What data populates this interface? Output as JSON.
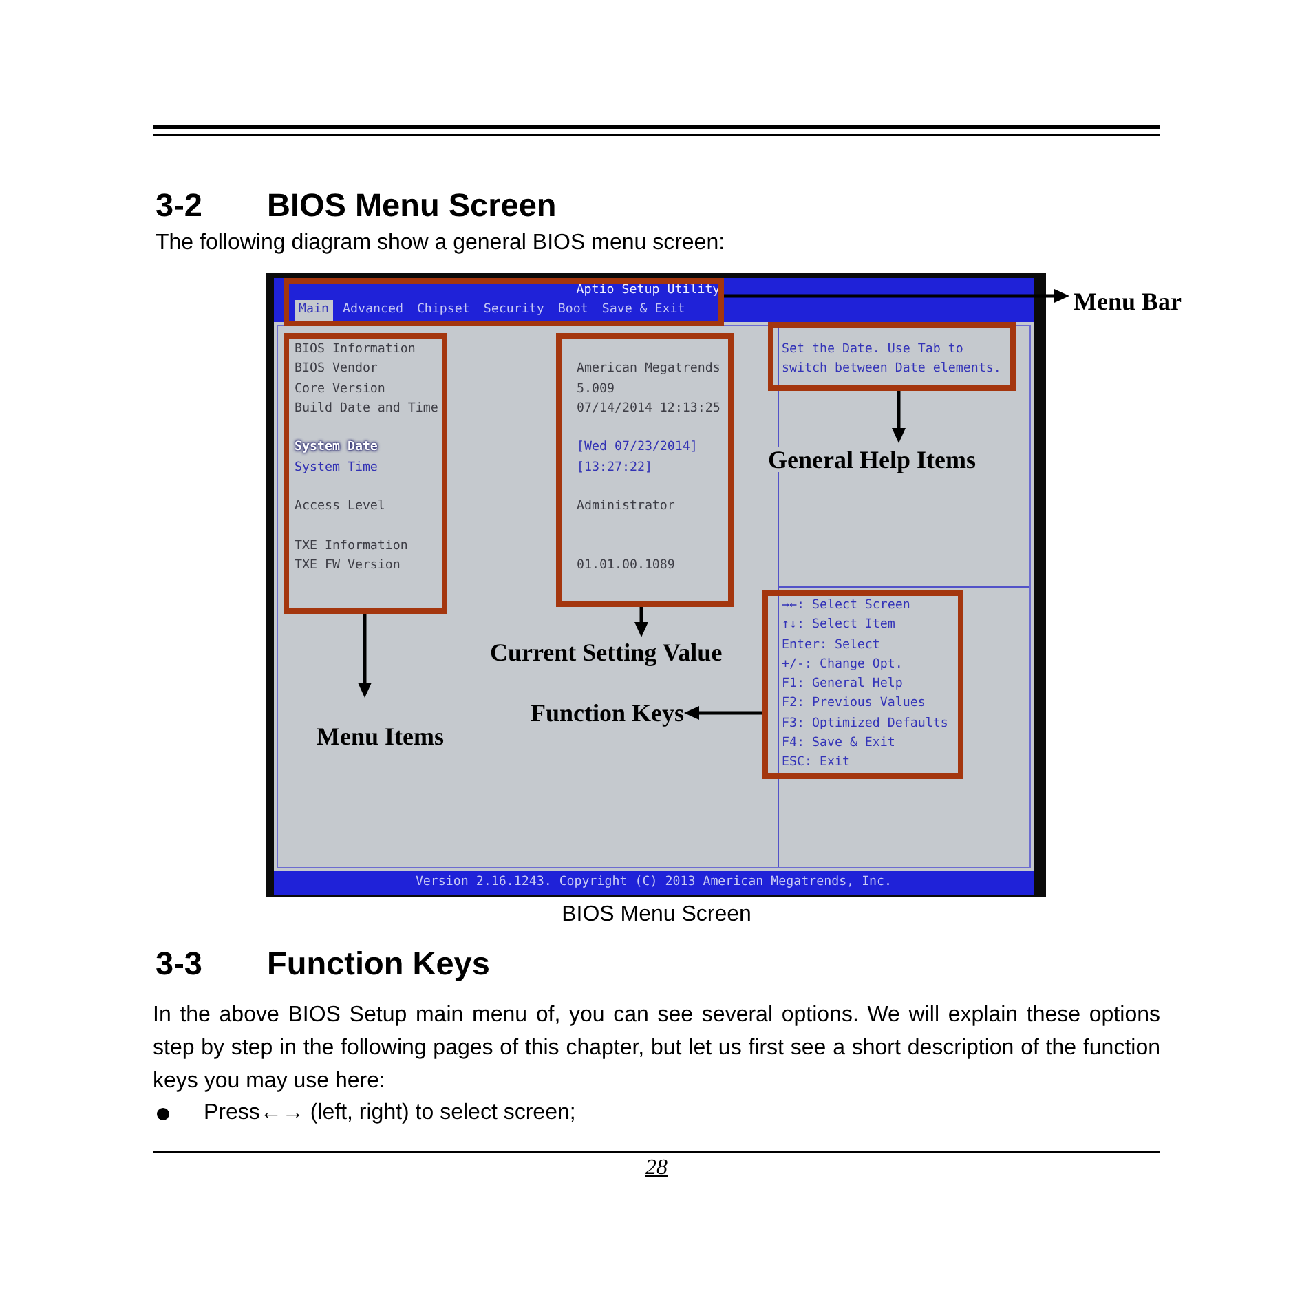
{
  "top_section": {
    "number": "3-2",
    "title": "BIOS Menu Screen",
    "intro": "The following diagram show a general BIOS menu screen:"
  },
  "figure": {
    "bios_screen": {
      "title": "Aptio Setup Utility",
      "tabs": [
        {
          "label": "Main",
          "selected": true
        },
        {
          "label": "Advanced",
          "selected": false
        },
        {
          "label": "Chipset",
          "selected": false
        },
        {
          "label": "Security",
          "selected": false
        },
        {
          "label": "Boot",
          "selected": false
        },
        {
          "label": "Save & Exit",
          "selected": false
        }
      ],
      "setting_groups": [
        {
          "items": [
            {
              "kind": "info",
              "label": "BIOS Information",
              "selected": false
            },
            {
              "kind": "info",
              "label": "BIOS Vendor",
              "value": "American Megatrends",
              "selected": false
            },
            {
              "kind": "info",
              "label": "Core Version",
              "value": "5.009",
              "selected": false
            },
            {
              "kind": "info",
              "label": "Build Date and Time",
              "value": "07/14/2014 12:13:25",
              "selected": false
            }
          ]
        },
        {
          "items": [
            {
              "kind": "setting",
              "label": "System Date",
              "value": "[Wed 07/23/2014]",
              "selected": true
            },
            {
              "kind": "setting",
              "label": "System Time",
              "value": "[13:27:22]",
              "selected": false
            }
          ]
        },
        {
          "items": [
            {
              "kind": "info",
              "label": "Access Level",
              "value": "Administrator",
              "selected": false
            }
          ]
        },
        {
          "items": [
            {
              "kind": "info",
              "label": "TXE Information",
              "selected": false
            },
            {
              "kind": "info",
              "label": "TXE FW Version",
              "value": "01.01.00.1089",
              "selected": false
            }
          ]
        }
      ],
      "help_text": "Set the Date. Use Tab to switch between Date elements.",
      "key_hints": [
        "→←: Select Screen",
        "↑↓: Select Item",
        "Enter: Select",
        "+/-: Change Opt.",
        "F1: General Help",
        "F2: Previous Values",
        "F3: Optimized Defaults",
        "F4: Save & Exit",
        "ESC: Exit"
      ],
      "version": "Version 2.16.1243. Copyright (C) 2013 American Megatrends, Inc."
    },
    "callouts": [
      {
        "label": "Menu Bar"
      },
      {
        "label": "Menu Items"
      },
      {
        "label": "Current Setting Value"
      },
      {
        "label": "General Help Items"
      },
      {
        "label": "Function Keys"
      }
    ],
    "caption": "BIOS Menu Screen"
  },
  "second_section": {
    "number": "3-3",
    "title": "Function Keys",
    "paragraph": "In the above BIOS Setup main menu of, you can see several options. We will explain these options step by step in the following pages of this chapter, but let us first see a short description of the function keys you may use here:",
    "bullets": [
      "Press←→ (left, right) to select screen;"
    ]
  },
  "page_number": "28"
}
